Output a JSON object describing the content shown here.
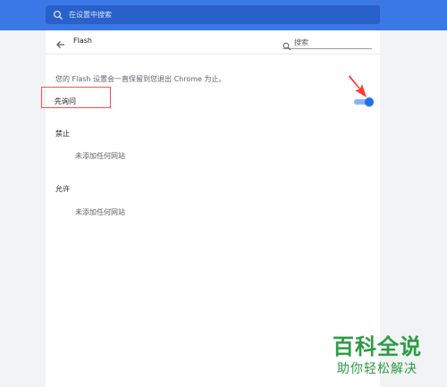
{
  "topbar": {
    "search_placeholder": "在设置中搜索"
  },
  "page": {
    "title": "Flash",
    "search_label": "搜索",
    "description": "您的 Flash 设置会一直保留到您退出 Chrome 为止。",
    "ask_first_label": "先询问",
    "toggle_on": true
  },
  "sections": {
    "block": {
      "title": "禁止",
      "empty": "未添加任何网站"
    },
    "allow": {
      "title": "允许",
      "empty": "未添加任何网站"
    }
  },
  "watermark": {
    "title": "百科全说",
    "subtitle": "助你轻松解决"
  },
  "colors": {
    "accent": "#3b78e7",
    "toggle": "#1a73e8",
    "highlight": "#ff4d4d",
    "watermark": "#2e9b45"
  }
}
